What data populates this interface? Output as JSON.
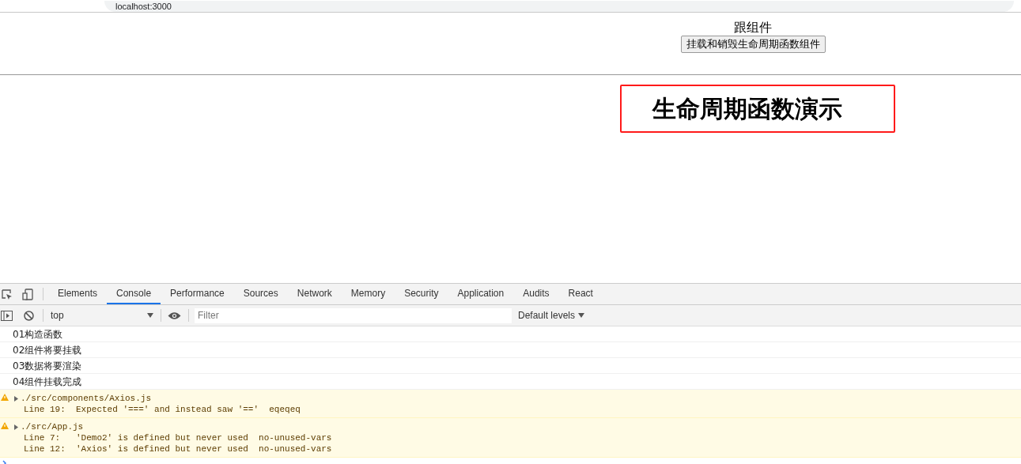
{
  "browser": {
    "url": "localhost:3000"
  },
  "page": {
    "title": "跟组件",
    "button": "挂载和销毁生命周期函数组件",
    "heading": "生命周期函数演示"
  },
  "devtools": {
    "tabs": [
      {
        "label": "Elements",
        "selected": false
      },
      {
        "label": "Console",
        "selected": true
      },
      {
        "label": "Performance",
        "selected": false
      },
      {
        "label": "Sources",
        "selected": false
      },
      {
        "label": "Network",
        "selected": false
      },
      {
        "label": "Memory",
        "selected": false
      },
      {
        "label": "Security",
        "selected": false
      },
      {
        "label": "Application",
        "selected": false
      },
      {
        "label": "Audits",
        "selected": false
      },
      {
        "label": "React",
        "selected": false
      }
    ],
    "context": "top",
    "filter": {
      "placeholder": "Filter"
    },
    "levels": "Default levels",
    "messages": [
      {
        "kind": "log",
        "text": "01构造函数"
      },
      {
        "kind": "log",
        "text": "02组件将要挂载"
      },
      {
        "kind": "log",
        "text": "03数据将要渲染"
      },
      {
        "kind": "log",
        "text": "04组件挂载完成"
      },
      {
        "kind": "warning",
        "text": "./src/components/Axios.js",
        "details": [
          "Line 19:  Expected '===' and instead saw '=='  eqeqeq"
        ]
      },
      {
        "kind": "warning",
        "text": "./src/App.js",
        "details": [
          "Line 7:   'Demo2' is defined but never used  no-unused-vars",
          "Line 12:  'Axios' is defined but never used  no-unused-vars"
        ]
      }
    ]
  }
}
